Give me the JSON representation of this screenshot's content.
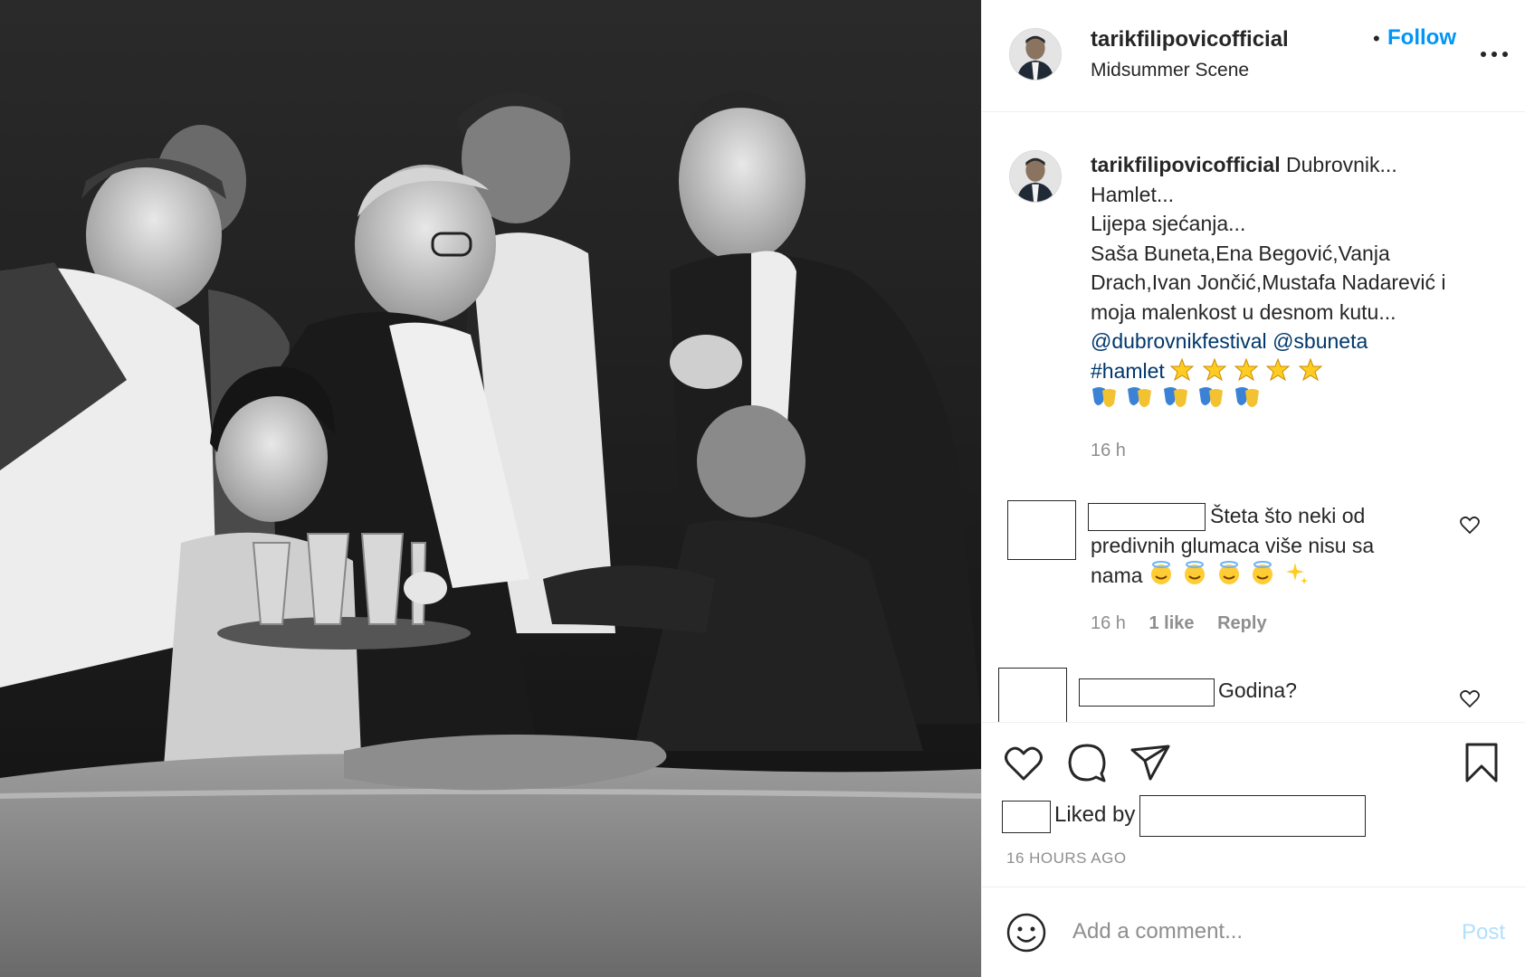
{
  "header": {
    "username": "tarikfilipovicofficial",
    "separator": "•",
    "follow_label": "Follow",
    "location": "Midsummer Scene"
  },
  "caption": {
    "username": "tarikfilipovicofficial",
    "line1": "Dubrovnik...",
    "line2": "Hamlet...",
    "line3": "Lijepa sjećanja...",
    "line4": "Saša Buneta,Ena Begović,Vanja",
    "line5": "Drach,Ivan Jončić,Mustafa Nadarević i",
    "line6": "moja malenkost u desnom kutu...",
    "mention1": "@dubrovnikfestival",
    "mention2": "@sbuneta",
    "hashtag": "#hamlet",
    "time": "16 h"
  },
  "comments": [
    {
      "line1": "Šteta što neki od",
      "line2": "predivnih glumaca više nisu sa",
      "line3": "nama",
      "time": "16 h",
      "likes": "1 like",
      "reply_label": "Reply"
    },
    {
      "line1": "Godina?"
    }
  ],
  "actions": {
    "liked_by_label": "Liked by",
    "time_ago": "16 HOURS AGO"
  },
  "add_comment": {
    "placeholder": "Add a comment...",
    "post_label": "Post"
  },
  "colors": {
    "link_blue": "#0095f6",
    "mention_blue": "#00376b",
    "muted": "#8e8e8e",
    "post_disabled": "#b2dffc"
  },
  "icons": [
    "more-icon",
    "heart-icon",
    "comment-icon",
    "share-icon",
    "bookmark-icon",
    "smile-icon",
    "star-emoji",
    "theatre-masks-emoji",
    "angel-face-emoji",
    "sparkles-emoji"
  ]
}
